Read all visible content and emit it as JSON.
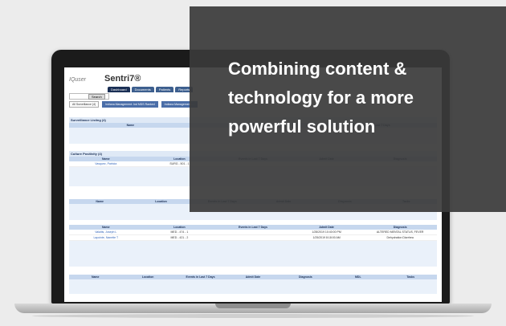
{
  "overlay": {
    "line1": "Combining content &",
    "line2": "technology for a more",
    "line3": "powerful solution"
  },
  "app": {
    "brand": "IQuser",
    "title": "Sentri7®",
    "tabs": [
      "Dashboard",
      "Documents",
      "Patients",
      "Reports"
    ],
    "search_label": "Search",
    "filters": [
      "All Surveillance (4)",
      "Indiana Management: Ind MDS Ranked",
      "Indiana Management: ..."
    ]
  },
  "sections": {
    "s1": {
      "title": "Surveillance Listing (4)",
      "headers": [
        "Name",
        "Location",
        "Events in Last 7 Days"
      ]
    },
    "s2": {
      "title": "Culture Positivity (4)",
      "headers": [
        "Name",
        "Location",
        "Events in Last 7 Days",
        "Admit Date",
        "Diagnosis"
      ],
      "rows": [
        [
          "Vasquez, Patricia",
          "SURG - 501 - 1",
          "",
          "",
          ""
        ]
      ]
    },
    "s3": {
      "headers": [
        "Name",
        "Location",
        "Events in Last 7 Days",
        "Admit Date",
        "Diagnosis",
        "Tasks"
      ]
    },
    "s4": {
      "headers": [
        "Name",
        "Location",
        "Events in Last 7 Days",
        "Admit Date",
        "Diagnosis"
      ],
      "rows": [
        [
          "Valaitis, Joseph L",
          "MED - 474 - 1",
          "",
          "1/28/2019 10:40:00 PM",
          "ALTERED MENTAL STATUS, FEVER"
        ],
        [
          "Lapointe, Nanette T",
          "MED - 421 - 2",
          "",
          "1/25/2019 8:18:00 AM",
          "Dehydration Diarrhea"
        ]
      ]
    },
    "s5": {
      "headers": [
        "Name",
        "Location",
        "Events in Last 7 Days",
        "Admit Date",
        "Diagnosis",
        "MDL",
        "Tasks"
      ]
    }
  }
}
